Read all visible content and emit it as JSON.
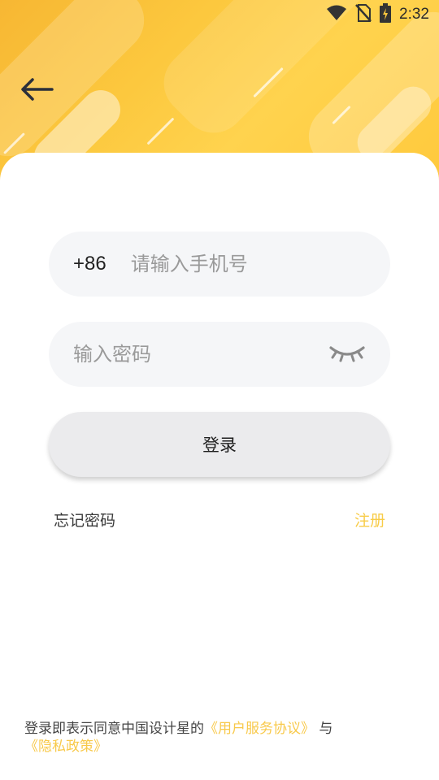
{
  "status_bar": {
    "time": "2:32",
    "icons": [
      "wifi-icon",
      "no-sim-icon",
      "battery-charging-icon"
    ]
  },
  "header": {
    "back_icon": "arrow-left-icon",
    "background_color": "#fcc83e"
  },
  "login_form": {
    "phone": {
      "prefix": "+86",
      "placeholder": "请输入手机号",
      "value": ""
    },
    "password": {
      "placeholder": "输入密码",
      "value": "",
      "toggle_icon": "eye-closed-icon"
    },
    "login_label": "登录",
    "forgot_label": "忘记密码",
    "register_label": "注册"
  },
  "agreement": {
    "prefix": "登录即表示同意中国设计星的",
    "user_agreement": "《用户服务协议》",
    "conjunction": "与",
    "privacy_policy": "《隐私政策》"
  },
  "colors": {
    "accent": "#f8cc48",
    "field_bg": "#f5f6f8",
    "button_bg": "#ebebed"
  }
}
